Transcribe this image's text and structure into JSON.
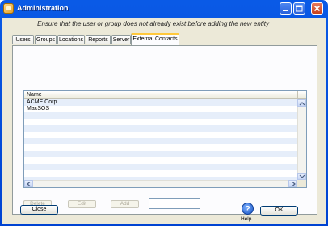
{
  "window": {
    "title": "Administration"
  },
  "hint_text": "Ensure that the user or group does not already exist before adding the new entity",
  "tabs": [
    {
      "label": "Users",
      "active": false
    },
    {
      "label": "Groups",
      "active": false
    },
    {
      "label": "Locations",
      "active": false
    },
    {
      "label": "Reports",
      "active": false
    },
    {
      "label": "Server",
      "active": false
    },
    {
      "label": "External Contacts",
      "active": true
    }
  ],
  "list": {
    "column_header": "Name",
    "items": [
      "ACME Corp.",
      "MacSOS"
    ]
  },
  "actions": {
    "delete_label": "Delete",
    "edit_label": "Edit",
    "add_label": "Add",
    "input_value": ""
  },
  "footer": {
    "close_label": "Close",
    "help_label": "Help",
    "ok_label": "OK"
  },
  "colors": {
    "titlebar": "#0a5ae6",
    "dialog_bg": "#ece9d8",
    "active_tab_accent": "#ffc83c",
    "row_stripe": "#e6eefa"
  }
}
